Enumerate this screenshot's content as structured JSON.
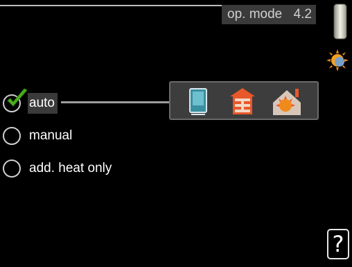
{
  "header": {
    "title": "op. mode",
    "code": "4.2"
  },
  "options": [
    {
      "label": "auto",
      "selected": true
    },
    {
      "label": "manual",
      "selected": false
    },
    {
      "label": "add. heat only",
      "selected": false
    }
  ],
  "mode_panel": {
    "icons": [
      "water-heater-icon",
      "heat-pump-icon",
      "additional-heat-icon"
    ]
  },
  "status_icons": [
    "hot-water-tank-icon",
    "sun-icon"
  ],
  "help": {
    "label": "?"
  },
  "colors": {
    "check_green": "#4caf1f",
    "panel_bg": "#3d3d3d",
    "heat_orange": "#e8582a"
  }
}
